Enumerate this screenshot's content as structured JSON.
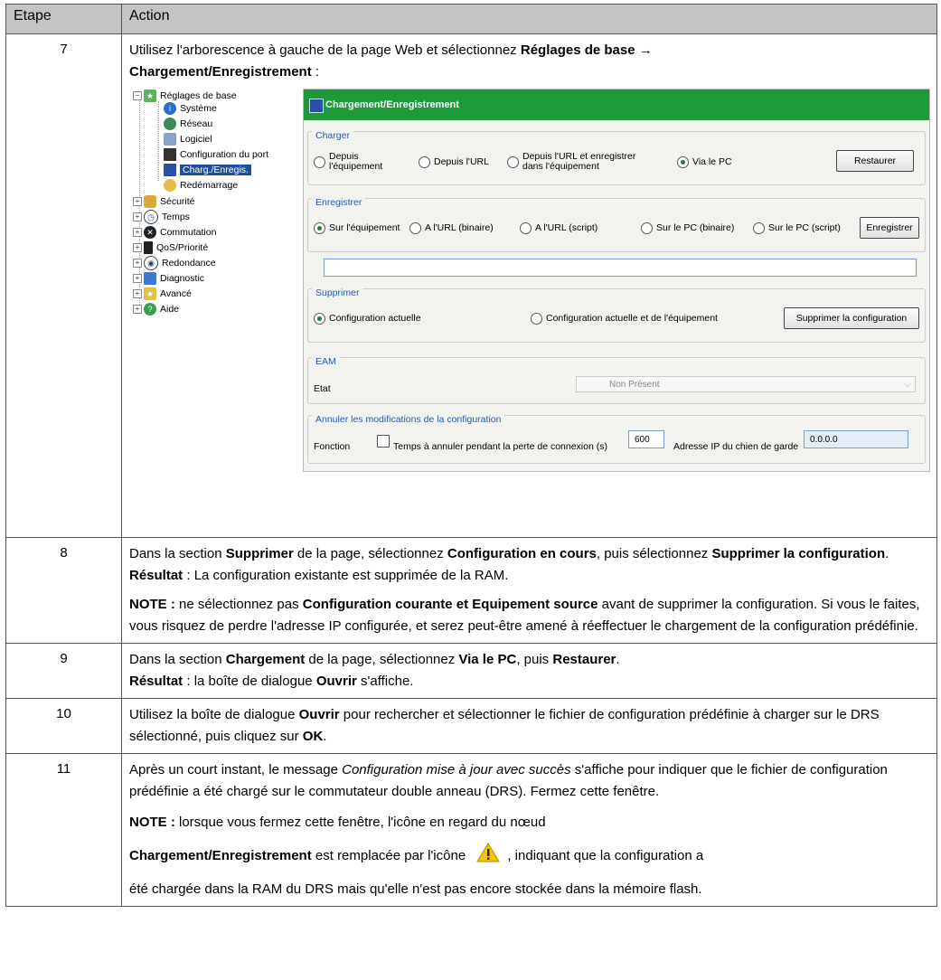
{
  "table": {
    "header": {
      "col_step": "Etape",
      "col_action": "Action"
    },
    "step7": {
      "num": "7",
      "text_a": "Utilisez l'arborescence à gauche de la page Web et sélectionnez ",
      "bold_a": "Réglages de base",
      "arrow": " → ",
      "bold_b": "Chargement/Enregistrement",
      "text_b": " :"
    },
    "step8": {
      "num": "8",
      "p1_a": "Dans la section ",
      "p1_b1": "Supprimer",
      "p1_c": " de la page, sélectionnez ",
      "p1_b2": "Configuration en cours",
      "p1_d": ", puis sélectionnez ",
      "p1_b3": "Supprimer la configuration",
      "p1_e": ".",
      "result_label": "Résultat",
      "result_text": " : La configuration existante est supprimée de la RAM.",
      "note_label": "NOTE :",
      "note_a": " ne sélectionnez pas ",
      "note_b": "Configuration courante et Equipement source",
      "note_c": " avant de supprimer la configuration. Si vous le faites, vous risquez de perdre l'adresse IP configurée, et serez peut-être amené à réeffectuer le chargement de la configuration prédéfinie."
    },
    "step9": {
      "num": "9",
      "a": "Dans la section ",
      "b1": "Chargement",
      "c": " de la page, sélectionnez ",
      "b2": "Via le PC",
      "d": ", puis ",
      "b3": "Restaurer",
      "e": ".",
      "result_label": "Résultat",
      "result_a": " : la boîte de dialogue ",
      "result_b": "Ouvrir",
      "result_c": " s'affiche."
    },
    "step10": {
      "num": "10",
      "a": "Utilisez la boîte de dialogue ",
      "b1": "Ouvrir",
      "c": " pour rechercher et sélectionner le fichier de configuration prédéfinie à charger sur le DRS sélectionné, puis cliquez sur ",
      "b2": "OK",
      "d": "."
    },
    "step11": {
      "num": "11",
      "a": "Après un court instant, le message ",
      "i": "Configuration mise à jour avec succès",
      "b": " s'affiche pour indiquer que le fichier de configuration prédéfinie a été chargé sur le commutateur double anneau (DRS). Fermez cette fenêtre.",
      "note_label": "NOTE :",
      "note_a": " lorsque vous fermez cette fenêtre, l'icône en regard du nœud",
      "note_b": "Chargement/Enregistrement",
      "note_c": " est remplacée par l'icône",
      "note_d": ", indiquant que la configuration a",
      "note_e": "été chargée dans la RAM du DRS mais qu'elle n'est pas encore stockée dans la mémoire flash."
    }
  },
  "tree": {
    "root": "Réglages de base",
    "children": [
      "Système",
      "Réseau",
      "Logiciel",
      "Configuration du port",
      "Charg./Enregis.",
      "Redémarrage"
    ],
    "nodes": [
      "Sécurité",
      "Temps",
      "Commutation",
      "QoS/Priorité",
      "Redondance",
      "Diagnostic",
      "Avancé",
      "Aide"
    ]
  },
  "panel": {
    "title": "Chargement/Enregistrement",
    "charger": {
      "legend": "Charger",
      "opt1": "Depuis\nl'équipement",
      "opt2": "Depuis l'URL",
      "opt3": "Depuis l'URL et enregistrer\ndans l'équipement",
      "opt4": "Via le PC",
      "button": "Restaurer",
      "selected": "Via le PC"
    },
    "enregistrer": {
      "legend": "Enregistrer",
      "opt1": "Sur l'équipement",
      "opt2": "A l'URL (binaire)",
      "opt3": "A l'URL (script)",
      "opt4": "Sur le PC (binaire)",
      "opt5": "Sur le PC (script)",
      "button": "Enregistrer",
      "url_value": "",
      "selected": "Sur l'équipement"
    },
    "supprimer": {
      "legend": "Supprimer",
      "opt1": "Configuration actuelle",
      "opt2": "Configuration actuelle et de l'équipement",
      "button": "Supprimer la configuration",
      "selected": "Configuration actuelle"
    },
    "eam": {
      "legend": "EAM",
      "label": "Etat",
      "value": "Non Présent"
    },
    "annuler": {
      "legend": "Annuler les modifications de la configuration",
      "fonction": "Fonction",
      "checkbox_label": "Temps à annuler pendant la perte de connexion (s)",
      "timeout": "600",
      "ip_label": "Adresse IP du chien de garde",
      "ip_value": "0.0.0.0"
    }
  },
  "colors": {
    "header_bg": "#c4c4c4",
    "panel_title_bg": "#1e9a38",
    "legend_text": "#2a5ba8",
    "tree_selected": "#1b4fa0"
  }
}
